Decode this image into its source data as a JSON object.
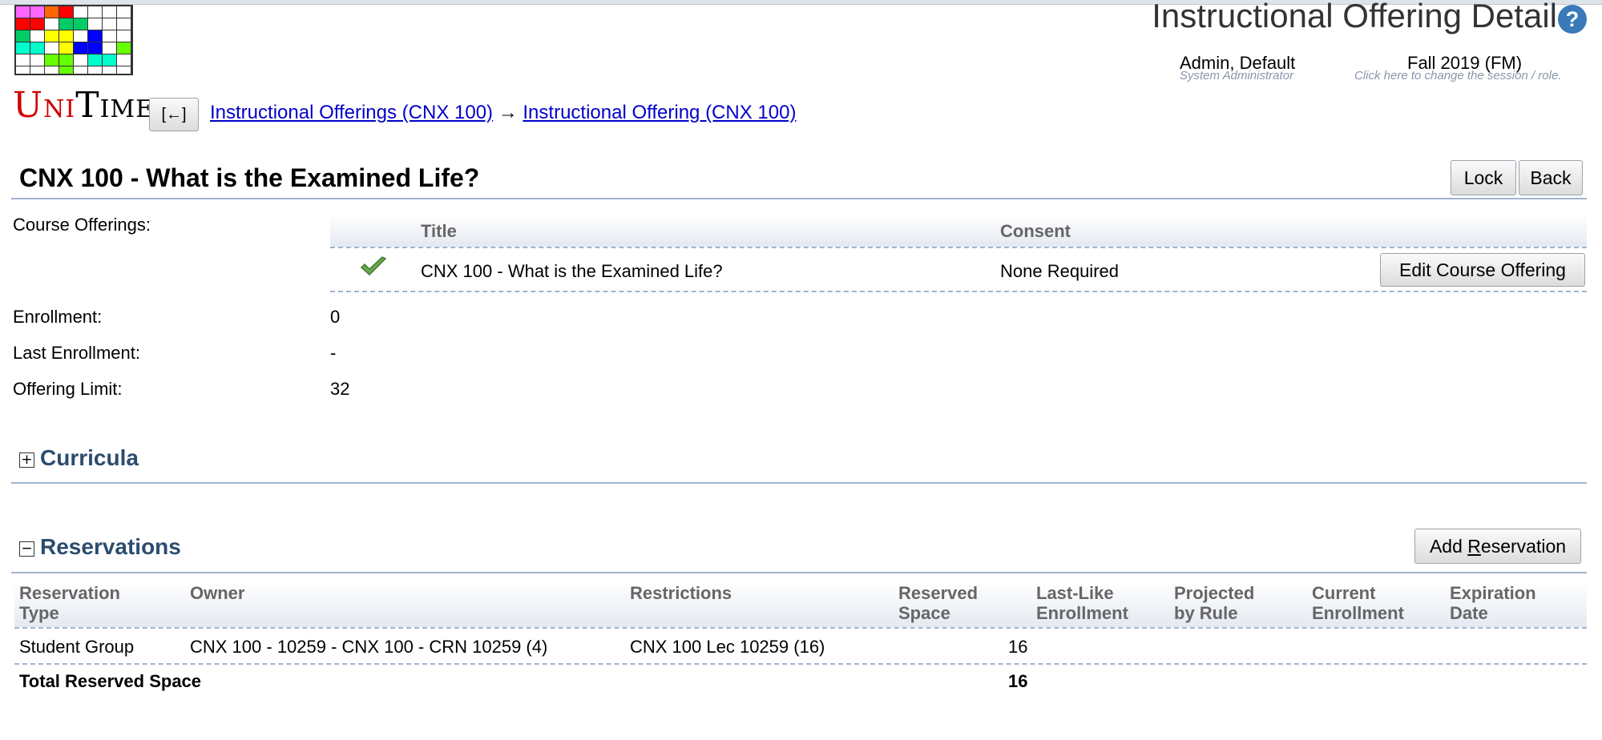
{
  "logo": {
    "text_a": "U",
    "text_b": "NI",
    "text_c": "T",
    "text_d": "IME",
    "grid_colors": [
      "#ff66ff",
      "#ff6600",
      "#ff0000",
      "#00cc66",
      "#ffff00",
      "#0000ff",
      "#00ffcc",
      "#66ff00"
    ]
  },
  "header": {
    "title": "Instructional Offering Detail",
    "help_icon": "?",
    "user_name": "Admin, Default",
    "user_role": "System Administrator",
    "session_name": "Fall 2019 (FM)",
    "session_hint": "Click here to change the session / role."
  },
  "nav": {
    "back_label": "[←]",
    "crumb1": "Instructional Offerings (CNX 100)",
    "arrow": "→",
    "crumb2": "Instructional Offering (CNX 100)"
  },
  "page": {
    "title": "CNX 100 - What is the Examined Life?",
    "lock_label": "Lock",
    "back_label": "Back"
  },
  "course_offerings": {
    "label": "Course Offerings:",
    "headers": {
      "title": "Title",
      "consent": "Consent"
    },
    "row": {
      "title": "CNX 100 - What is the Examined Life?",
      "consent": "None Required",
      "edit_label": "Edit Course Offering"
    }
  },
  "details": {
    "enrollment_label": "Enrollment:",
    "enrollment_value": "0",
    "last_enrollment_label": "Last Enrollment:",
    "last_enrollment_value": "-",
    "offering_limit_label": "Offering Limit:",
    "offering_limit_value": "32"
  },
  "curricula": {
    "toggle": "+",
    "title": "Curricula"
  },
  "reservations": {
    "toggle": "−",
    "title": "Reservations",
    "add_prefix": "Add ",
    "add_accel": "R",
    "add_suffix": "eservation",
    "headers": {
      "type_1": "Reservation",
      "type_2": "Type",
      "owner": "Owner",
      "restrictions": "Restrictions",
      "reserved_1": "Reserved",
      "reserved_2": "Space",
      "lastlike_1": "Last-Like",
      "lastlike_2": "Enrollment",
      "projected_1": "Projected",
      "projected_2": "by Rule",
      "current_1": "Current",
      "current_2": "Enrollment",
      "expiration_1": "Expiration",
      "expiration_2": "Date"
    },
    "row": {
      "type": "Student Group",
      "owner": "CNX 100 - 10259 - CNX 100 - CRN 10259 (4)",
      "restrictions": "CNX 100 Lec 10259 (16)",
      "reserved": "16"
    },
    "total_label": "Total Reserved Space",
    "total_value": "16"
  }
}
